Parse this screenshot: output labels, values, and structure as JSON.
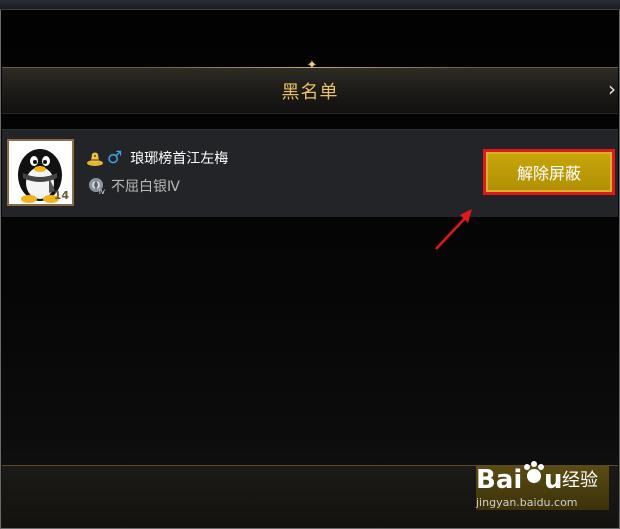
{
  "header": {
    "title": "黑名单",
    "next_arrow": "›"
  },
  "blacklist": [
    {
      "player_name": "琅琊榜首江左梅",
      "gender_symbol": "♂",
      "tier_name": "不屈白银Ⅳ",
      "avatar_badge": "14",
      "unblock_label": "解除屏蔽"
    }
  ],
  "watermark": {
    "brand": "Bai du 经验",
    "url": "jingyan.baidu.com"
  },
  "colors": {
    "title_gold": "#e6c16a",
    "button_gold": "#c8a60a",
    "annotation_red": "#e01a1a",
    "gender_blue": "#3da6e6"
  },
  "icons": {
    "rank": "rank-hat-icon",
    "tier": "silver-tier-icon"
  }
}
